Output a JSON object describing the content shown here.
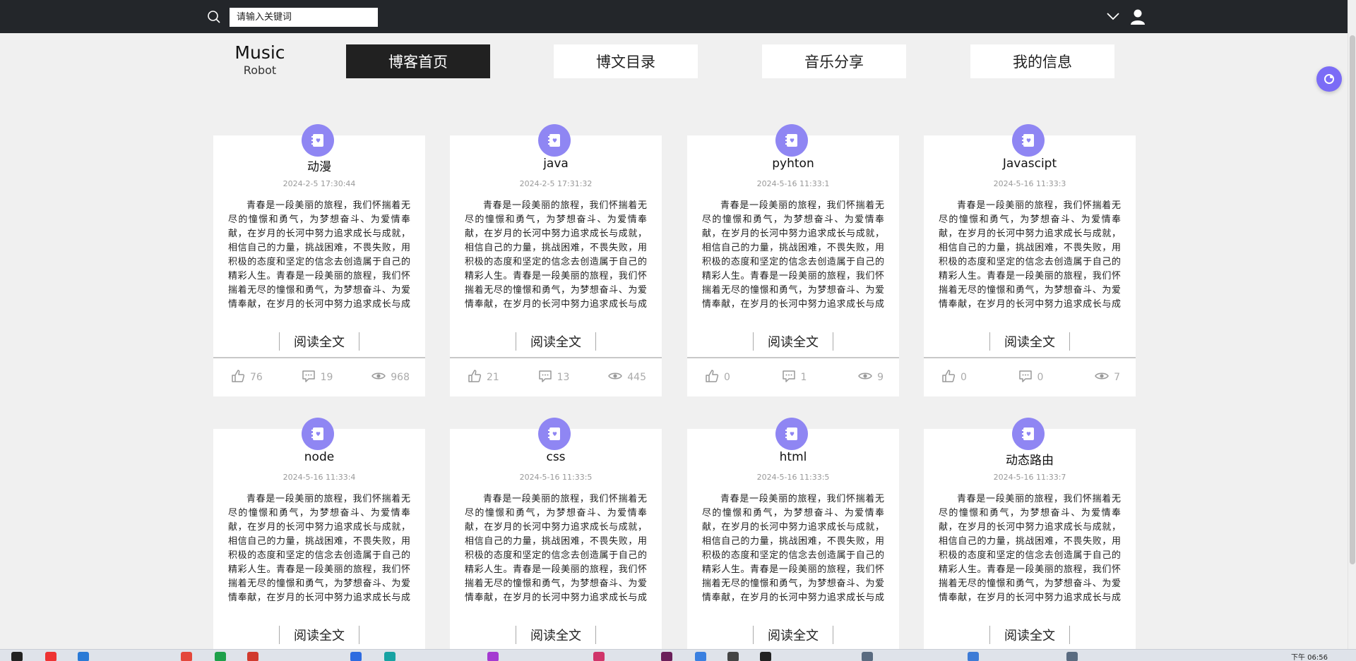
{
  "search": {
    "placeholder": "请输入关键词"
  },
  "logo": {
    "title": "Music",
    "subtitle": "Robot"
  },
  "nav": [
    {
      "label": "博客首页",
      "active": true
    },
    {
      "label": "博文目录",
      "active": false
    },
    {
      "label": "音乐分享",
      "active": false
    },
    {
      "label": "我的信息",
      "active": false
    }
  ],
  "accent_color": "#8f86f3",
  "read_more_label": "阅读全文",
  "posts": [
    {
      "title": "动漫",
      "date": "2024-2-5 17:30:44",
      "likes": "76",
      "comments": "19",
      "views": "968",
      "excerpt": "青春是一段美丽的旅程，我们怀揣着无尽的憧憬和勇气，为梦想奋斗、为爱情奉献，在岁月的长河中努力追求成长与成就，相信自己的力量，挑战困难，不畏失败，用积极的态度和坚定的信念去创造属于自己的精彩人生。青春是一段美丽的旅程，我们怀揣着无尽的憧憬和勇气，为梦想奋斗、为爱情奉献，在岁月的长河中努力追求成长与成就"
    },
    {
      "title": "java",
      "date": "2024-2-5 17:31:32",
      "likes": "21",
      "comments": "13",
      "views": "445",
      "excerpt": "青春是一段美丽的旅程，我们怀揣着无尽的憧憬和勇气，为梦想奋斗、为爱情奉献，在岁月的长河中努力追求成长与成就，相信自己的力量，挑战困难，不畏失败，用积极的态度和坚定的信念去创造属于自己的精彩人生。青春是一段美丽的旅程，我们怀揣着无尽的憧憬和勇气，为梦想奋斗、为爱情奉献，在岁月的长河中努力追求成长与成就"
    },
    {
      "title": "pyhton",
      "date": "2024-5-16 11:33:1",
      "likes": "0",
      "comments": "1",
      "views": "9",
      "excerpt": "青春是一段美丽的旅程，我们怀揣着无尽的憧憬和勇气，为梦想奋斗、为爱情奉献，在岁月的长河中努力追求成长与成就，相信自己的力量，挑战困难，不畏失败，用积极的态度和坚定的信念去创造属于自己的精彩人生。青春是一段美丽的旅程，我们怀揣着无尽的憧憬和勇气，为梦想奋斗、为爱情奉献，在岁月的长河中努力追求成长与成就"
    },
    {
      "title": "Javascipt",
      "date": "2024-5-16 11:33:3",
      "likes": "0",
      "comments": "0",
      "views": "7",
      "excerpt": "青春是一段美丽的旅程，我们怀揣着无尽的憧憬和勇气，为梦想奋斗、为爱情奉献，在岁月的长河中努力追求成长与成就，相信自己的力量，挑战困难，不畏失败，用积极的态度和坚定的信念去创造属于自己的精彩人生。青春是一段美丽的旅程，我们怀揣着无尽的憧憬和勇气，为梦想奋斗、为爱情奉献，在岁月的长河中努力追求成长与成就"
    },
    {
      "title": "node",
      "date": "2024-5-16 11:33:4",
      "likes": "",
      "comments": "",
      "views": "",
      "excerpt": "青春是一段美丽的旅程，我们怀揣着无尽的憧憬和勇气，为梦想奋斗、为爱情奉献，在岁月的长河中努力追求成长与成就，相信自己的力量，挑战困难，不畏失败，用积极的态度和坚定的信念去创造属于自己的精彩人生。青春是一段美丽的旅程，我们怀揣着无尽的憧憬和勇气，为梦想奋斗、为爱情奉献，在岁月的长河中努力追求成长与成就"
    },
    {
      "title": "css",
      "date": "2024-5-16 11:33:5",
      "likes": "",
      "comments": "",
      "views": "",
      "excerpt": "青春是一段美丽的旅程，我们怀揣着无尽的憧憬和勇气，为梦想奋斗、为爱情奉献，在岁月的长河中努力追求成长与成就，相信自己的力量，挑战困难，不畏失败，用积极的态度和坚定的信念去创造属于自己的精彩人生。青春是一段美丽的旅程，我们怀揣着无尽的憧憬和勇气，为梦想奋斗、为爱情奉献，在岁月的长河中努力追求成长与成就"
    },
    {
      "title": "html",
      "date": "2024-5-16 11:33:5",
      "likes": "",
      "comments": "",
      "views": "",
      "excerpt": "青春是一段美丽的旅程，我们怀揣着无尽的憧憬和勇气，为梦想奋斗、为爱情奉献，在岁月的长河中努力追求成长与成就，相信自己的力量，挑战困难，不畏失败，用积极的态度和坚定的信念去创造属于自己的精彩人生。青春是一段美丽的旅程，我们怀揣着无尽的憧憬和勇气，为梦想奋斗、为爱情奉献，在岁月的长河中努力追求成长与成就"
    },
    {
      "title": "动态路由",
      "date": "2024-5-16 11:33:7",
      "likes": "",
      "comments": "",
      "views": "",
      "excerpt": "青春是一段美丽的旅程，我们怀揣着无尽的憧憬和勇气，为梦想奋斗、为爱情奉献，在岁月的长河中努力追求成长与成就，相信自己的力量，挑战困难，不畏失败，用积极的态度和坚定的信念去创造属于自己的精彩人生。青春是一段美丽的旅程，我们怀揣着无尽的憧憬和勇气，为梦想奋斗、为爱情奉献，在岁月的长河中努力追求成长与成就"
    }
  ],
  "taskbar": {
    "clock": "下午 06:56"
  }
}
